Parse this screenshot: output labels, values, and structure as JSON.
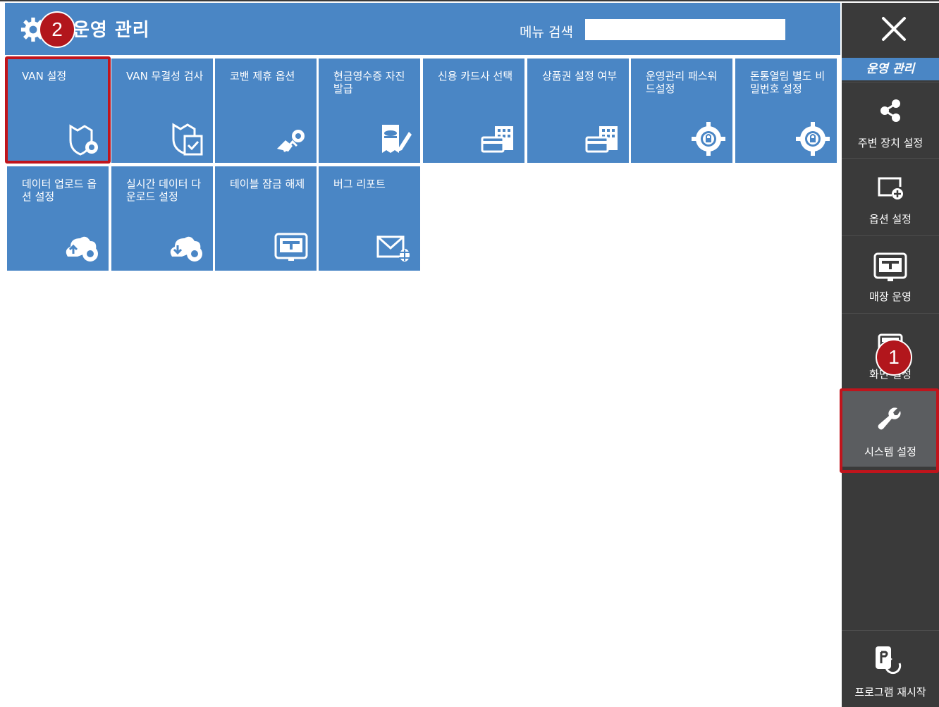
{
  "header": {
    "title": "운영 관리",
    "search_label": "메뉴 검색",
    "search_value": ""
  },
  "tiles": [
    {
      "label": "VAN 설정",
      "icon": "shield-gear-icon"
    },
    {
      "label": "VAN 무결성 검사",
      "icon": "shield-check-icon"
    },
    {
      "label": "코밴 제휴 옵션",
      "icon": "handshake-gear-icon"
    },
    {
      "label": "현금영수증 자진발급",
      "icon": "receipt-edit-icon"
    },
    {
      "label": "신용 카드사 선택",
      "icon": "card-building-icon"
    },
    {
      "label": "상품권 설정 여부",
      "icon": "card-building-icon"
    },
    {
      "label": "운영관리 패스워드설정",
      "icon": "gear-lock-icon"
    },
    {
      "label": "돈통열림 별도 비밀번호 설정",
      "icon": "gear-lock-icon"
    },
    {
      "label": "데이터 업로드 옵션 설정",
      "icon": "cloud-upload-gear-icon"
    },
    {
      "label": "실시간 데이터 다운로드 설정",
      "icon": "cloud-download-gear-icon"
    },
    {
      "label": "테이블 잠금 해제",
      "icon": "table-screen-icon"
    },
    {
      "label": "버그 리포트",
      "icon": "mail-bug-icon"
    }
  ],
  "sidebar": {
    "title": "운영 관리",
    "items": [
      {
        "label": "주변 장치 설정",
        "icon": "share-icon"
      },
      {
        "label": "옵션 설정",
        "icon": "window-add-icon"
      },
      {
        "label": "매장 운영",
        "icon": "store-screen-icon"
      },
      {
        "label": "화면 설정",
        "icon": "screen-icon"
      },
      {
        "label": "시스템 설정",
        "icon": "wrench-icon"
      }
    ],
    "restart_label": "프로그램 재시작"
  },
  "badges": {
    "first": "1",
    "second": "2"
  },
  "colors": {
    "tile_blue": "#4a86c5",
    "sidebar_dark": "#3a3a3a",
    "active_item": "#5b5d60",
    "highlight_red": "#c0141c"
  }
}
